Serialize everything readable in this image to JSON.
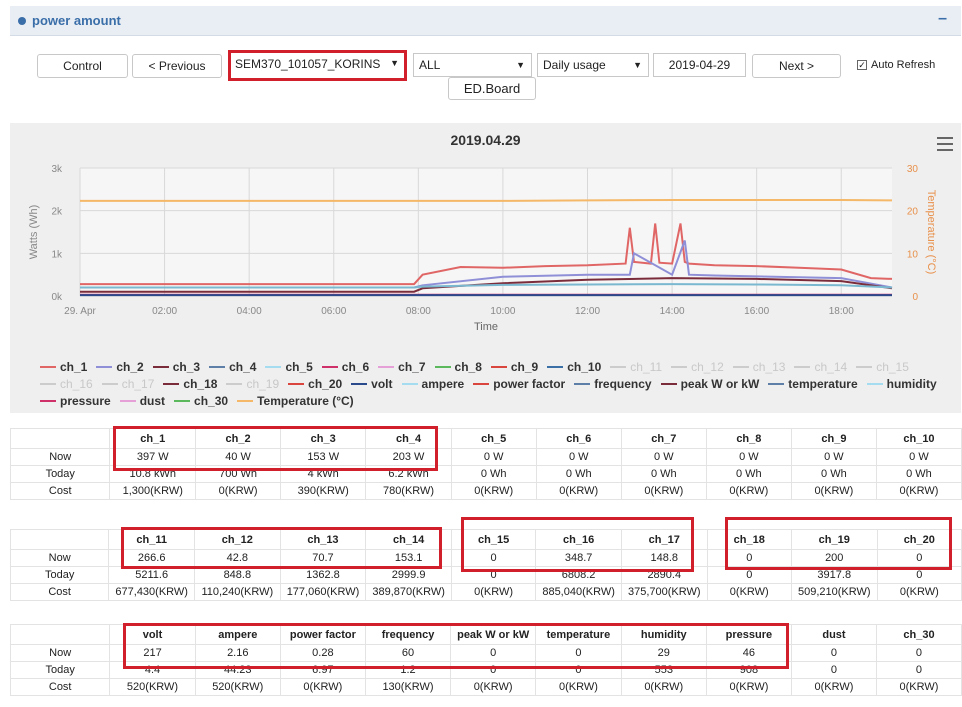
{
  "panel": {
    "title": "power amount",
    "collapse": "–"
  },
  "toolbar": {
    "control": "Control",
    "previous": "< Previous",
    "device": "SEM370_101057_KORINS",
    "channel": "ALL",
    "mode": "Daily usage",
    "date": "2019-04-29",
    "next": "Next >",
    "edboard": "ED.Board",
    "auto_refresh": "Auto Refresh",
    "auto_refresh_checked": true
  },
  "chart_data": {
    "type": "line",
    "title": "2019.04.29",
    "xlabel": "Time",
    "ylabel": "Watts (Wh)",
    "y2label": "Temperature (°C)",
    "x_ticks": [
      "29. Apr",
      "02:00",
      "04:00",
      "06:00",
      "08:00",
      "10:00",
      "12:00",
      "14:00",
      "16:00",
      "18:00"
    ],
    "y_ticks": [
      "0k",
      "1k",
      "2k",
      "3k"
    ],
    "y2_ticks": [
      "0",
      "10",
      "20",
      "30"
    ],
    "ylim": [
      0,
      3000
    ],
    "y2lim": [
      0,
      30
    ],
    "xlim": [
      0,
      19.2
    ],
    "grid": true,
    "legend_position": "bottom",
    "series": [
      {
        "name": "Temperature (°C)",
        "color": "#f4b868",
        "axis": "right",
        "x": [
          0,
          2,
          4,
          6,
          8,
          10,
          12,
          14,
          16,
          18,
          19.2
        ],
        "values": [
          22.3,
          22.3,
          22.3,
          22.3,
          22.3,
          22.3,
          22.4,
          22.5,
          22.5,
          22.5,
          22.4
        ]
      },
      {
        "name": "ch_1",
        "color": "#e06666",
        "axis": "left",
        "x": [
          0,
          2,
          4,
          6,
          7.9,
          8.1,
          9,
          10,
          11,
          12,
          12.9,
          13,
          13.1,
          13.5,
          13.6,
          13.7,
          14,
          14.2,
          14.3,
          14.4,
          15,
          16,
          17,
          18,
          18.7,
          19.2
        ],
        "values": [
          280,
          280,
          280,
          280,
          280,
          500,
          680,
          660,
          700,
          720,
          760,
          1600,
          800,
          760,
          1700,
          780,
          760,
          1700,
          800,
          760,
          720,
          700,
          660,
          620,
          420,
          400
        ]
      },
      {
        "name": "ch_2",
        "color": "#8f8fd8",
        "axis": "left",
        "x": [
          0,
          7.9,
          8.1,
          10,
          12,
          13,
          13.1,
          14,
          14.3,
          14.4,
          15,
          18,
          19.2
        ],
        "values": [
          200,
          200,
          250,
          450,
          500,
          500,
          1000,
          500,
          1300,
          500,
          480,
          420,
          200
        ]
      },
      {
        "name": "ch_3",
        "color": "#7b2c3a",
        "axis": "left",
        "x": [
          0,
          7.9,
          8.1,
          10,
          12,
          14,
          16,
          18,
          19.2
        ],
        "values": [
          100,
          100,
          180,
          300,
          380,
          420,
          400,
          350,
          180
        ]
      },
      {
        "name": "ch_4",
        "color": "#7ab8d0",
        "axis": "left",
        "x": [
          0,
          7.9,
          8.1,
          10,
          12,
          14,
          16,
          18,
          19.2
        ],
        "values": [
          200,
          200,
          220,
          260,
          270,
          280,
          270,
          250,
          200
        ]
      },
      {
        "name": "ch_6",
        "color": "#d0306a",
        "axis": "left",
        "x": [
          0,
          19.2
        ],
        "values": [
          30,
          30
        ]
      },
      {
        "name": "volt",
        "color": "#2b4a8c",
        "axis": "left",
        "x": [
          0,
          19.2
        ],
        "values": [
          20,
          20
        ]
      }
    ]
  },
  "legend": [
    {
      "label": "ch_1",
      "color": "#e06666",
      "muted": false
    },
    {
      "label": "ch_2",
      "color": "#8f8fd8",
      "muted": false
    },
    {
      "label": "ch_3",
      "color": "#7b2c3a",
      "muted": false
    },
    {
      "label": "ch_4",
      "color": "#5d7fa8",
      "muted": false
    },
    {
      "label": "ch_5",
      "color": "#a6dcef",
      "muted": false
    },
    {
      "label": "ch_6",
      "color": "#d0306a",
      "muted": false
    },
    {
      "label": "ch_7",
      "color": "#e6a0d8",
      "muted": false
    },
    {
      "label": "ch_8",
      "color": "#5cb85c",
      "muted": false
    },
    {
      "label": "ch_9",
      "color": "#d9463e",
      "muted": false
    },
    {
      "label": "ch_10",
      "color": "#3a70a6",
      "muted": false
    },
    {
      "label": "ch_11",
      "color": "#cccccc",
      "muted": true
    },
    {
      "label": "ch_12",
      "color": "#cccccc",
      "muted": true
    },
    {
      "label": "ch_13",
      "color": "#cccccc",
      "muted": true
    },
    {
      "label": "ch_14",
      "color": "#cccccc",
      "muted": true
    },
    {
      "label": "ch_15",
      "color": "#cccccc",
      "muted": true
    },
    {
      "label": "ch_16",
      "color": "#cccccc",
      "muted": true
    },
    {
      "label": "ch_17",
      "color": "#cccccc",
      "muted": true
    },
    {
      "label": "ch_18",
      "color": "#7b2c3a",
      "muted": false
    },
    {
      "label": "ch_19",
      "color": "#cccccc",
      "muted": true
    },
    {
      "label": "ch_20",
      "color": "#d9463e",
      "muted": false
    },
    {
      "label": "volt",
      "color": "#2b4a8c",
      "muted": false
    },
    {
      "label": "ampere",
      "color": "#a6dcef",
      "muted": false
    },
    {
      "label": "power factor",
      "color": "#d9463e",
      "muted": false
    },
    {
      "label": "frequency",
      "color": "#5d7fa8",
      "muted": false
    },
    {
      "label": "peak W or kW",
      "color": "#7b2c3a",
      "muted": false
    },
    {
      "label": "temperature",
      "color": "#5d7fa8",
      "muted": false
    },
    {
      "label": "humidity",
      "color": "#a6dcef",
      "muted": false
    },
    {
      "label": "pressure",
      "color": "#d0306a",
      "muted": false
    },
    {
      "label": "dust",
      "color": "#e6a0d8",
      "muted": false
    },
    {
      "label": "ch_30",
      "color": "#5cb85c",
      "muted": false
    },
    {
      "label": "Temperature (°C)",
      "color": "#f4b868",
      "muted": false
    }
  ],
  "tables": [
    {
      "headers": [
        "",
        "ch_1",
        "ch_2",
        "ch_3",
        "ch_4",
        "ch_5",
        "ch_6",
        "ch_7",
        "ch_8",
        "ch_9",
        "ch_10"
      ],
      "rows": [
        [
          "Now",
          "397 W",
          "40 W",
          "153 W",
          "203 W",
          "0 W",
          "0 W",
          "0 W",
          "0 W",
          "0 W",
          "0 W"
        ],
        [
          "Today",
          "10.8 kWh",
          "700 Wh",
          "4 kWh",
          "6.2 kWh",
          "0 Wh",
          "0 Wh",
          "0 Wh",
          "0 Wh",
          "0 Wh",
          "0 Wh"
        ],
        [
          "Cost",
          "1,300(KRW)",
          "0(KRW)",
          "390(KRW)",
          "780(KRW)",
          "0(KRW)",
          "0(KRW)",
          "0(KRW)",
          "0(KRW)",
          "0(KRW)",
          "0(KRW)"
        ]
      ]
    },
    {
      "headers": [
        "",
        "ch_11",
        "ch_12",
        "ch_13",
        "ch_14",
        "ch_15",
        "ch_16",
        "ch_17",
        "ch_18",
        "ch_19",
        "ch_20"
      ],
      "rows": [
        [
          "Now",
          "266.6",
          "42.8",
          "70.7",
          "153.1",
          "0",
          "348.7",
          "148.8",
          "0",
          "200",
          "0"
        ],
        [
          "Today",
          "5211.6",
          "848.8",
          "1362.8",
          "2999.9",
          "0",
          "6808.2",
          "2890.4",
          "0",
          "3917.8",
          "0"
        ],
        [
          "Cost",
          "677,430(KRW)",
          "110,240(KRW)",
          "177,060(KRW)",
          "389,870(KRW)",
          "0(KRW)",
          "885,040(KRW)",
          "375,700(KRW)",
          "0(KRW)",
          "509,210(KRW)",
          "0(KRW)"
        ]
      ]
    },
    {
      "headers": [
        "",
        "volt",
        "ampere",
        "power factor",
        "frequency",
        "peak W or kW",
        "temperature",
        "humidity",
        "pressure",
        "dust",
        "ch_30"
      ],
      "rows": [
        [
          "Now",
          "217",
          "2.16",
          "0.28",
          "60",
          "0",
          "0",
          "29",
          "46",
          "0",
          "0"
        ],
        [
          "Today",
          "4.4",
          "44.23",
          "6.97",
          "1.2",
          "0",
          "0",
          "553",
          "908",
          "0",
          "0"
        ],
        [
          "Cost",
          "520(KRW)",
          "520(KRW)",
          "0(KRW)",
          "130(KRW)",
          "0(KRW)",
          "0(KRW)",
          "0(KRW)",
          "0(KRW)",
          "0(KRW)",
          "0(KRW)"
        ]
      ]
    }
  ]
}
